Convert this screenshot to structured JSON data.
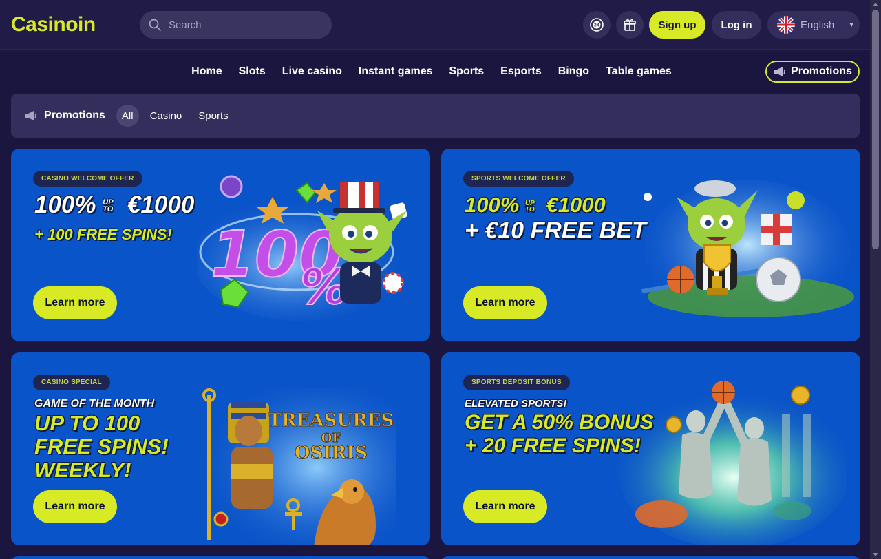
{
  "header": {
    "logo_text": "Casinoin",
    "search_placeholder": "Search",
    "support_icon": "support-24-icon",
    "gift_icon": "gift-icon",
    "signup_label": "Sign up",
    "login_label": "Log in",
    "language": "English",
    "language_flag": "uk-flag-icon"
  },
  "nav": {
    "items": [
      "Home",
      "Slots",
      "Live casino",
      "Instant games",
      "Sports",
      "Esports",
      "Bingo",
      "Table games"
    ],
    "promotions_label": "Promotions"
  },
  "subnav": {
    "title": "Promotions",
    "filters": [
      "All",
      "Casino",
      "Sports"
    ],
    "active_filter": "All"
  },
  "cards": [
    {
      "badge": "Casino welcome offer",
      "line1": "100%",
      "up_to": "UP TO",
      "amount": "€1000",
      "line2": "+ 100 FREE SPINS!",
      "button": "Learn more"
    },
    {
      "badge": "Sports welcome offer",
      "line1": "100%",
      "up_to": "UP TO",
      "amount": "€1000",
      "line2": "+ €10 FREE BET",
      "button": "Learn more"
    },
    {
      "badge": "Casino special",
      "line1": "GAME OF THE MONTH",
      "line2": "UP TO 100",
      "line3": "FREE SPINS!",
      "line4": "WEEKLY!",
      "art_text1": "TREASURES",
      "art_text2": "OF",
      "art_text3": "OSIRIS",
      "button": "Learn more"
    },
    {
      "badge": "Sports deposit bonus",
      "line1": "ELEVATED SPORTS!",
      "line2": "GET A 50% BONUS",
      "line3": "+ 20 FREE SPINS!",
      "button": "Learn more"
    }
  ],
  "colors": {
    "accent": "#d8ea26",
    "background": "#1a1640",
    "card": "#0a54c9"
  }
}
